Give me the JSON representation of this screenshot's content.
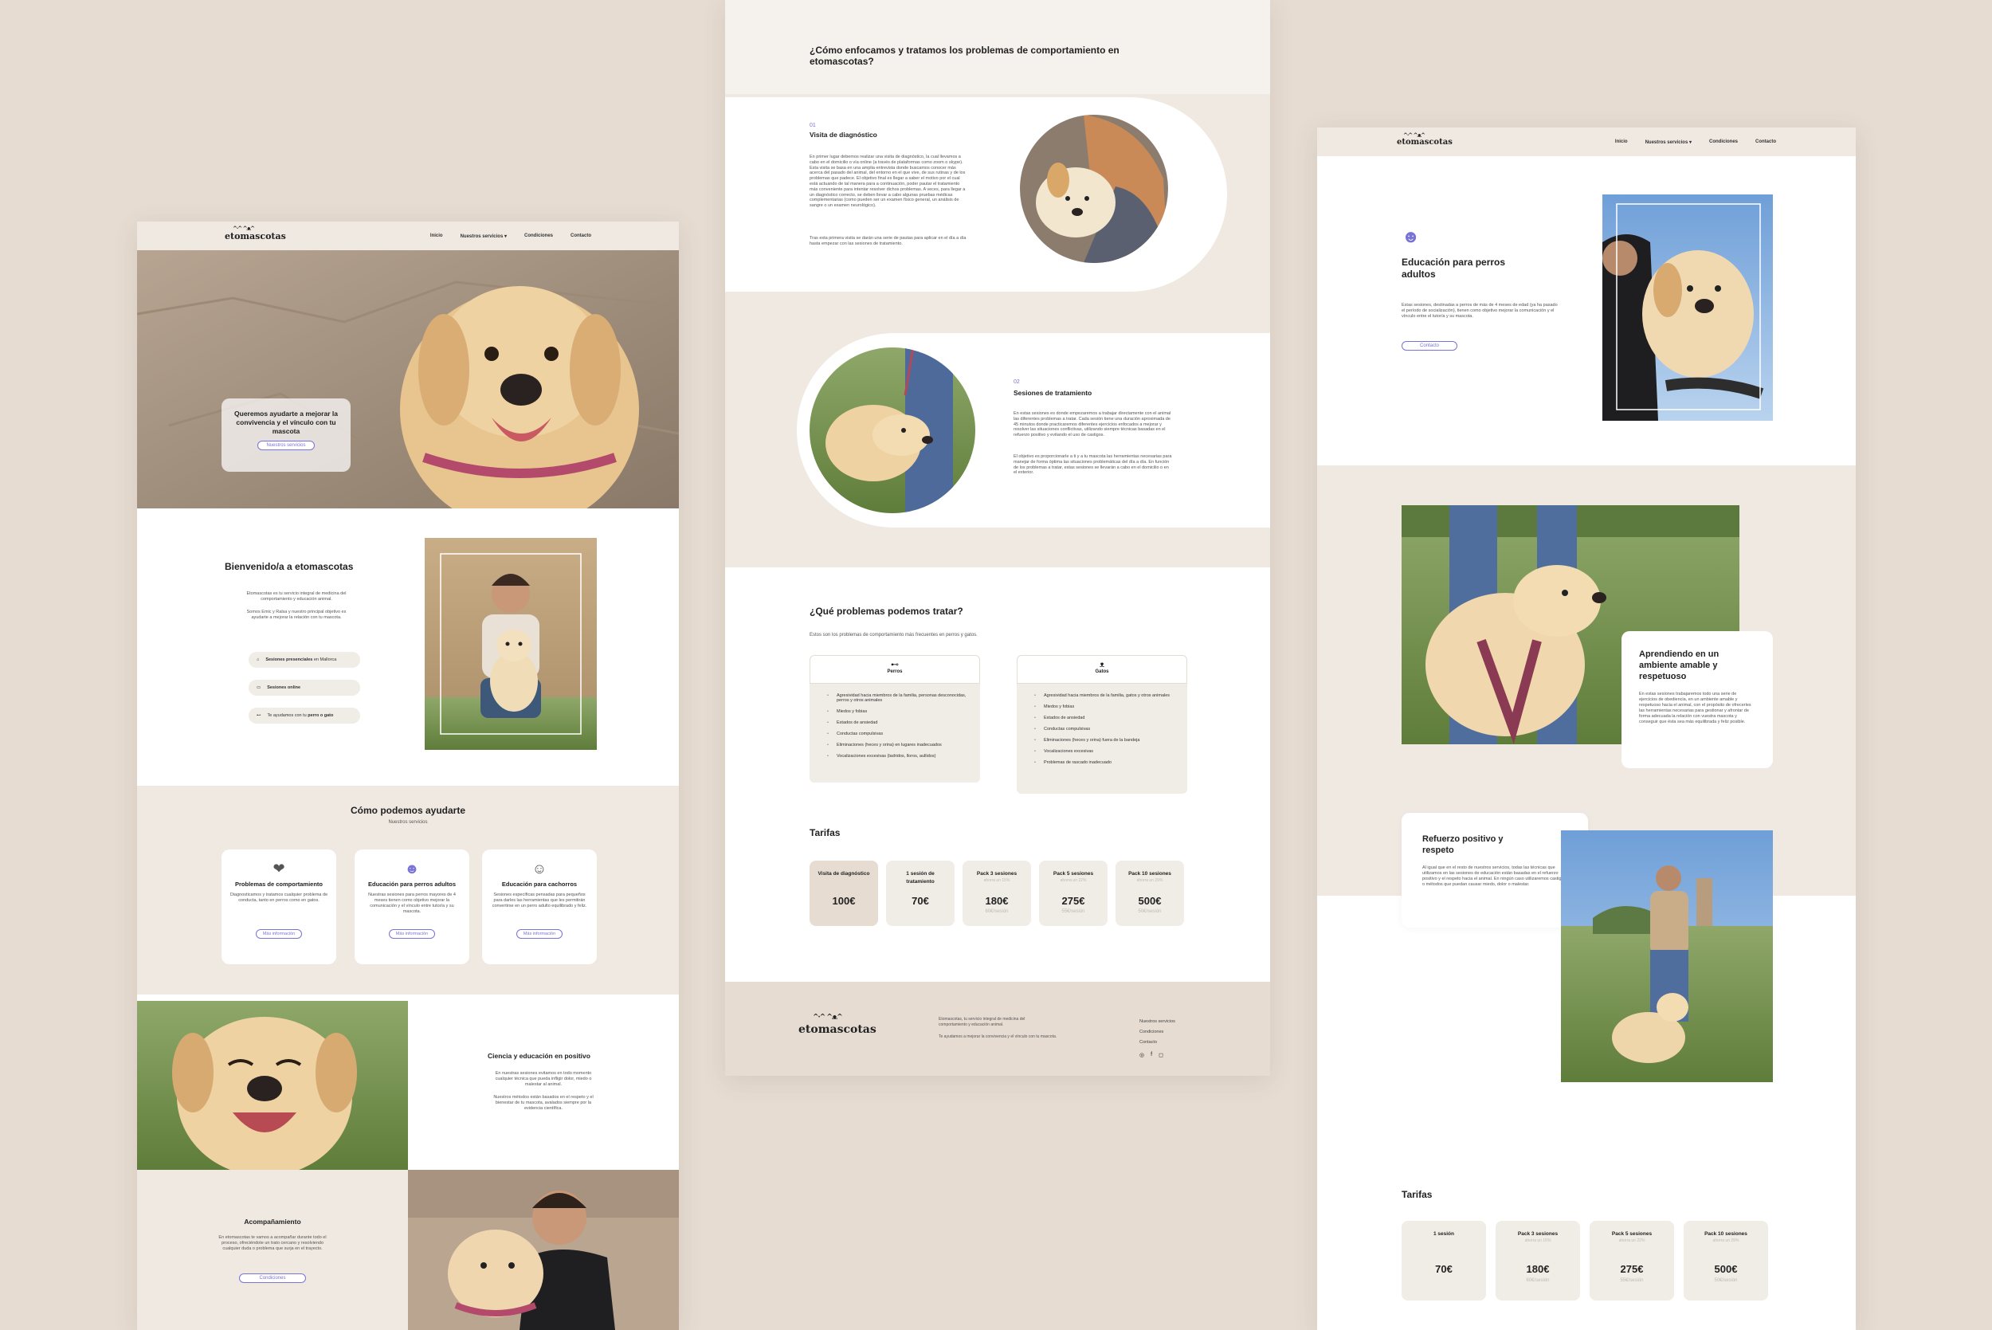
{
  "brand": {
    "logo": "etomascotas",
    "logo_mark": "^·^ ^ᴥ^"
  },
  "nav": {
    "home": "Inicio",
    "services": "Nuestros servicios",
    "conditions": "Condiciones",
    "contact": "Contacto",
    "caret": "▾"
  },
  "home": {
    "hero_text": "Queremos ayudarte a mejorar la convivencia y el vínculo con tu mascota",
    "hero_button": "Nuestros servicios",
    "welcome_title": "Bienvenido/a a etomascotas",
    "welcome_p1": "Etomascotas es tu servicio integral de medicina del comportamiento y educación animal.",
    "welcome_p2": "Somos Emic y Ralsa y nuestro principal objetivo es ayudarte a mejorar la relación con tu mascota.",
    "pill1_bold": "Sesiones presenciales",
    "pill1_rest": " en Mallorca",
    "pill2": "Sesiones online",
    "pill3_rest": "Te ayudamos con tu ",
    "pill3_bold": "perro o gato",
    "help_title": "Cómo podemos ayudarte",
    "help_subtitle": "Nuestros servicios",
    "services": [
      {
        "title": "Problemas de comportamiento",
        "desc": "Diagnosticamos y tratamos cualquier problema de conducta, tanto en perros como en gatos.",
        "button": "Más información"
      },
      {
        "title": "Educación para perros adultos",
        "desc": "Nuestras sesiones para perros mayores de 4 meses tienen como objetivo mejorar la comunicación y el vínculo entre tutor/a y su mascota.",
        "button": "Más información"
      },
      {
        "title": "Educación para cachorros",
        "desc": "Sesiones específicas pensadas para pequeños para darles las herramientas que les permitirán convertirse en un perro adulto equilibrado y feliz.",
        "button": "Más información"
      }
    ],
    "science_title": "Ciencia y educación en positivo",
    "science_p1": "En nuestras sesiones evitamos en todo momento cualquier técnica que pueda infligir dolor, miedo o malestar al animal.",
    "science_p2": "Nuestros métodos están basados en el respeto y el bienestar de tu mascota, avalados siempre por la evidencia científica.",
    "accomp_title": "Acompañamiento",
    "accomp_p": "En etomascotas te vamos a acompañar durante todo el proceso, ofreciéndote un trato cercano y resolviendo cualquier duda o problema que surja en el trayecto.",
    "accomp_button": "Condiciones"
  },
  "behavior": {
    "title": "¿Cómo enfocamos y tratamos los problemas de comportamiento en etomascotas?",
    "step1_num": "01",
    "step1_title": "Visita de diagnóstico",
    "step1_p1": "En primer lugar debemos realizar una visita de diagnóstico, la cual llevamos a cabo en el domicilio o vía online (a través de plataformas como zoom o skype). Esta visita se basa en una amplia entrevista donde buscamos conocer más acerca del pasado del animal, del entorno en el que vive, de sus rutinas y de los problemas que padece. El objetivo final es llegar a saber el motivo por el cual está actuando de tal manera para a continuación, poder pautar el tratamiento más conveniente para intentar resolver dichos problemas. A veces, para llegar a un diagnóstico correcto, se deben llevar a cabo algunas pruebas médicas complementarias (como pueden ser un examen físico general, un análisis de sangre o un examen neurológico).",
    "step1_p2": "Tras esta primera visita se darán una serie de pautas para aplicar en el día a día hasta empezar con las sesiones de tratamiento.",
    "step2_num": "02",
    "step2_title": "Sesiones de tratamiento",
    "step2_p1": "En estas sesiones es donde empezaremos a trabajar directamente con el animal las diferentes problemas a tratar. Cada sesión tiene una duración aproximada de 45 minutos donde practicaremos diferentes ejercicios enfocados a mejorar y resolver las situaciones conflictivas, utilizando siempre técnicas basadas en el refuerzo positivo y evitando el uso de castigos.",
    "step2_p2": "El objetivo es proporcionarle a ti y a tu mascota las herramientas necesarias para manejar de forma óptima las situaciones problemáticas del día a día. En función de los problemas a tratar, estas sesiones se llevarán a cabo en el domicilio o en el exterior.",
    "problems_title": "¿Qué problemas podemos tratar?",
    "problems_subtitle": "Estos son los problemas de comportamiento más frecuentes en perros y gatos.",
    "dogs_label": "Perros",
    "cats_label": "Gatos",
    "dogs": [
      "Agresividad hacia miembros de la familia, personas desconocidas, perros y otros animales",
      "Miedos y fobias",
      "Estados de ansiedad",
      "Conductas compulsivas",
      "Eliminaciones (heces y orina) en lugares inadecuados",
      "Vocalizaciones excesivas (ladridos, lloros, aullidos)"
    ],
    "cats": [
      "Agresividad hacia miembros de la familia, gatos y otros animales",
      "Miedos y fobias",
      "Estados de ansiedad",
      "Conductas compulsivas",
      "Eliminaciones (heces y orina) fuera de la bandeja",
      "Vocalizaciones excesivas",
      "Problemas de rascado inadecuado"
    ],
    "tariffs_title": "Tarifas",
    "tariffs": [
      {
        "name": "Visita de diagnóstico",
        "price": "100€",
        "sub": ""
      },
      {
        "name": "1 sesión de tratamiento",
        "price": "70€",
        "sub": ""
      },
      {
        "name": "Pack 3 sesiones",
        "price": "180€",
        "sub": "60€/sesión",
        "note": "ahorra un 15%"
      },
      {
        "name": "Pack 5 sesiones",
        "price": "275€",
        "sub": "55€/sesión",
        "note": "ahorra un 22%"
      },
      {
        "name": "Pack 10 sesiones",
        "price": "500€",
        "sub": "50€/sesión",
        "note": "ahorra un 29%"
      }
    ],
    "footer_p1": "Etomascotas, tu servicio integral de medicina del comportamiento y educación animal.",
    "footer_p2": "Te ayudamos a mejorar la convivencia y el vínculo con tu mascota.",
    "footer_links": [
      "Nuestros servicios",
      "Condiciones",
      "Contacto"
    ],
    "footer_icons": [
      "◎",
      "f",
      "◻"
    ]
  },
  "adult": {
    "title": "Educación para perros adultos",
    "desc": "Estas sesiones, destinadas a perros de más de 4 meses de edad (ya ha pasado el período de socialización), tienen como objetivo mejorar la comunicación y el vínculo entre el tutor/a y su mascota.",
    "button": "Contacto",
    "learn_title": "Aprendiendo en un ambiente amable y respetuoso",
    "learn_p": "En estas sesiones trabajaremos todo una serie de ejercicios de obediencia, en un ambiente amable y respetuoso hacia el animal, con el propósito de ofrecerles las herramientas necesarias para gestionar y afrontar de forma adecuada la relación con vuestra mascota y conseguir que ésta sea más equilibrada y feliz posible.",
    "ref_title": "Refuerzo positivo y respeto",
    "ref_p": "Al igual que en el resto de nuestros servicios, todas las técnicas que utilizamos en las sesiones de educación están basadas en el refuerzo positivo y el respeto hacia el animal. En ningún caso utilizaremos castigos o métodos que puedan causar miedo, dolor o malestar.",
    "tariffs_title": "Tarifas",
    "tariffs": [
      {
        "name": "1 sesión",
        "price": "70€",
        "sub": ""
      },
      {
        "name": "Pack 3 sesiones",
        "price": "180€",
        "sub": "60€/sesión",
        "note": "ahorra un 15%"
      },
      {
        "name": "Pack 5 sesiones",
        "price": "275€",
        "sub": "55€/sesión",
        "note": "ahorra un 22%"
      },
      {
        "name": "Pack 10 sesiones",
        "price": "500€",
        "sub": "50€/sesión",
        "note": "ahorra un 29%"
      }
    ]
  },
  "colors": {
    "background": "#e6dcd2",
    "accent": "#7a73d6",
    "beige": "#efe9e1",
    "card": "#f0ece6",
    "highlight": "#e6dcd2"
  }
}
